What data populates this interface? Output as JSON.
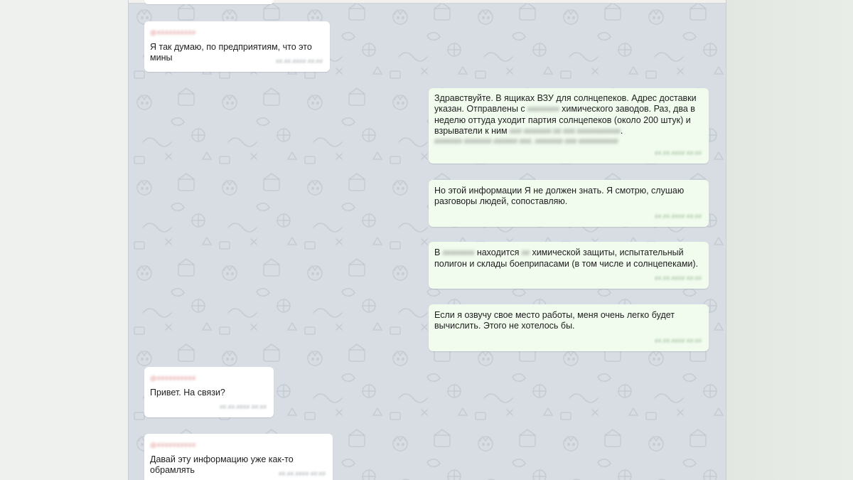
{
  "colors": {
    "chat_background": "#d7dde3",
    "incoming_bubble": "#ffffff",
    "outgoing_bubble": "#f1fbee",
    "sender_name": "#e08a8a"
  },
  "messages": [
    {
      "id": "m1",
      "direction": "incoming",
      "sender": "@##########",
      "text": "Я так думаю, по предприятиям, что это мины",
      "time": "##.##.#### ##:##"
    },
    {
      "id": "m2",
      "direction": "outgoing",
      "lines": [
        "Здравствуйте. В ящиках ВЗУ для солнцепеков. Адрес доставки",
        "указан. Отправлены с",
        "химического заводов. Раз, два в",
        "неделю оттуда уходит партия солнцепеков (около 200 штук) и",
        "взрыватели к ним",
        "."
      ],
      "redacted": [
        "########",
        "### ####### ## ### ###########",
        "####### ####### ###### ###. ####### ### ##########"
      ],
      "time": "##.##.#### ##:##"
    },
    {
      "id": "m3",
      "direction": "outgoing",
      "lines": [
        "Но этой информации Я не должен знать. Я смотрю, слушаю",
        "разговоры людей, сопоставляю."
      ],
      "time": "##.##.#### ##:##"
    },
    {
      "id": "m4",
      "direction": "outgoing",
      "lines": [
        "В",
        "находится",
        "химической защиты, испытательный",
        "полигон и склады боеприпасами (в том числе и солнцепеками)."
      ],
      "redacted": [
        "########",
        "##"
      ],
      "time": "##.##.#### ##:##"
    },
    {
      "id": "m5",
      "direction": "outgoing",
      "lines": [
        "Если я озвучу свое место работы, меня очень легко будет",
        "вычислить. Этого не хотелось бы."
      ],
      "time": "##.##.#### ##:##"
    },
    {
      "id": "m6",
      "direction": "incoming",
      "sender": "@##########",
      "text": "Привет. На связи?",
      "time": "##.##.#### ##:##"
    },
    {
      "id": "m7",
      "direction": "incoming",
      "sender": "@##########",
      "text": "Давай эту информацию уже как-то обрамлять",
      "time": "##.##.#### ##:##"
    }
  ]
}
